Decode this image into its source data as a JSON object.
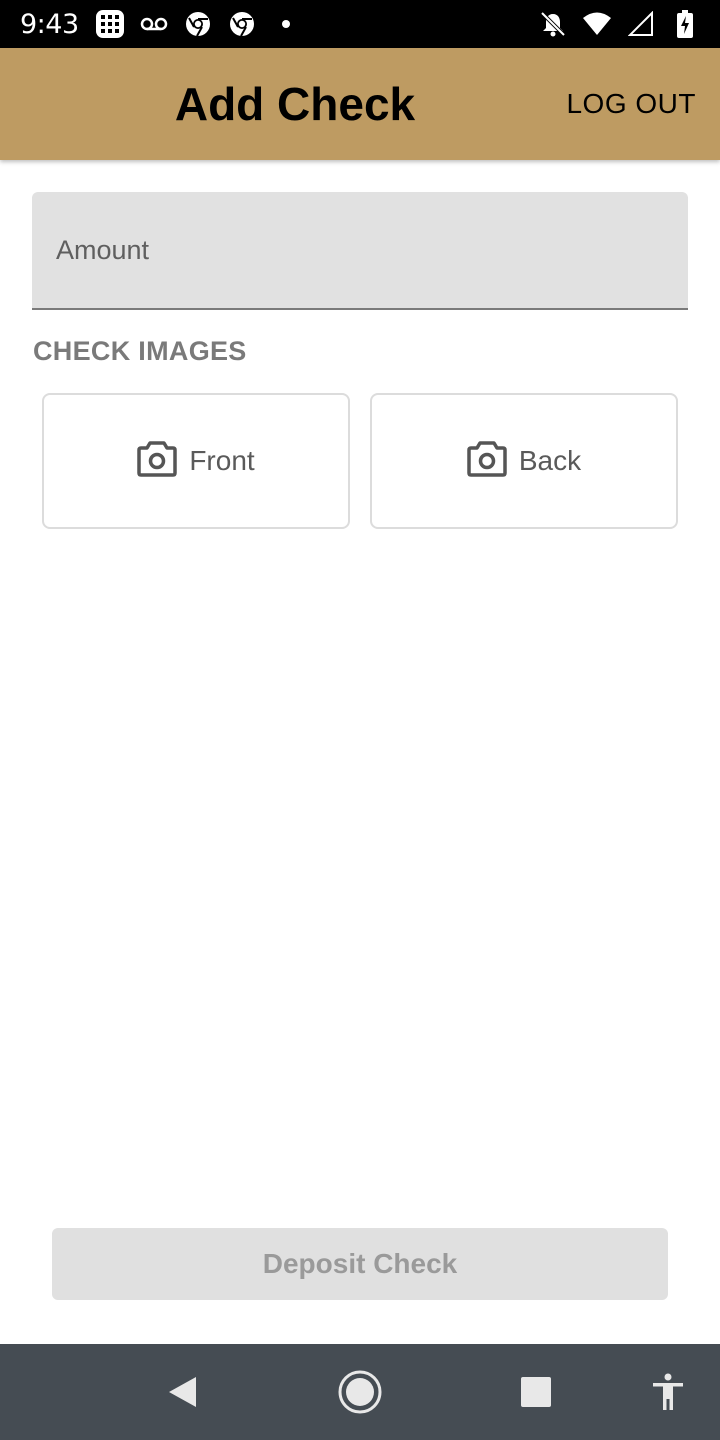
{
  "status_bar": {
    "time": "9:43",
    "left_icons": [
      "app-notification-icon",
      "voicemail-icon",
      "chrome-icon",
      "chrome-icon",
      "dot-icon"
    ],
    "right_icons": [
      "notifications-off-icon",
      "wifi-icon",
      "cell-signal-icon",
      "battery-charging-icon"
    ]
  },
  "app_bar": {
    "title": "Add Check",
    "logout_label": "LOG OUT",
    "color": "#be9b62"
  },
  "form": {
    "amount_placeholder": "Amount",
    "amount_value": "",
    "check_images_label": "CHECK IMAGES",
    "front_label": "Front",
    "back_label": "Back",
    "deposit_label": "Deposit Check"
  },
  "nav_bar": {
    "buttons": [
      "back-icon",
      "home-icon",
      "recents-icon",
      "accessibility-icon"
    ]
  }
}
